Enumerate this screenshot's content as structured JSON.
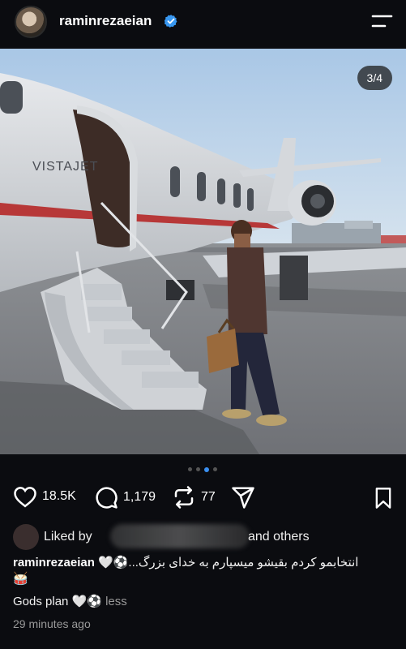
{
  "header": {
    "username": "raminrezaeian",
    "verified": true
  },
  "post": {
    "counter": "3/4",
    "carousel_total": 4,
    "carousel_active": 3,
    "photo_text": {
      "jet_brand": "VISTAJET"
    }
  },
  "actions": {
    "likes": "18.5K",
    "comments": "1,179",
    "reposts": "77"
  },
  "liked": {
    "prefix": "Liked by",
    "suffix": "and others"
  },
  "caption": {
    "username": "raminrezaeian",
    "text": "انتخابمو کردم بقیشو میسپارم به خدای بزرگ...⚽🤍",
    "emoji_line": "🥁",
    "second_line": "Gods plan 🤍⚽",
    "less_label": "less"
  },
  "timestamp": "29 minutes ago",
  "colors": {
    "background": "#0b0c10",
    "verified": "#3897f0",
    "active_dot": "#3a8ff0"
  }
}
